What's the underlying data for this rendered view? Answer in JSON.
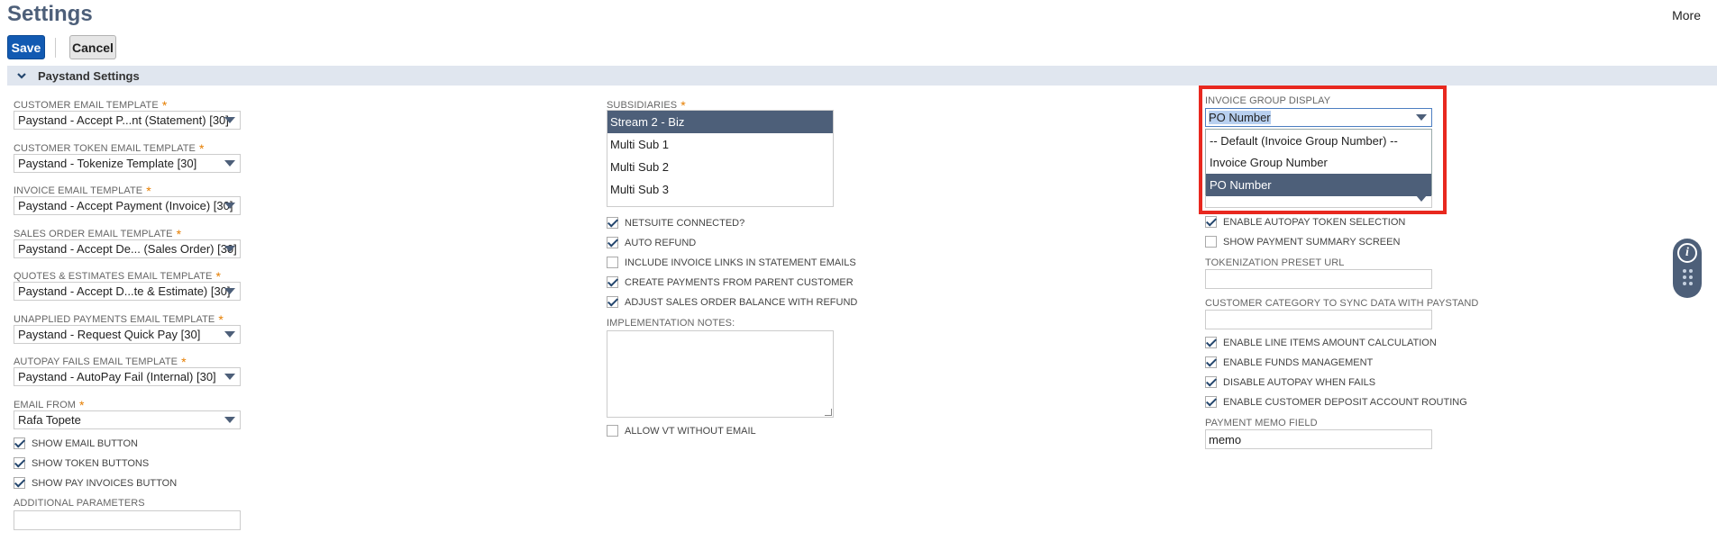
{
  "header": {
    "title": "Settings",
    "more_label": "More",
    "save_label": "Save",
    "cancel_label": "Cancel"
  },
  "section": {
    "title": "Paystand Settings"
  },
  "left_column": {
    "fields": [
      {
        "label": "CUSTOMER EMAIL TEMPLATE",
        "value": "Paystand - Accept P...nt (Statement) [30]"
      },
      {
        "label": "CUSTOMER TOKEN EMAIL TEMPLATE",
        "value": "Paystand - Tokenize Template [30]"
      },
      {
        "label": "INVOICE EMAIL TEMPLATE",
        "value": "Paystand - Accept Payment (Invoice) [30]"
      },
      {
        "label": "SALES ORDER EMAIL TEMPLATE",
        "value": "Paystand - Accept De... (Sales Order) [30]"
      },
      {
        "label": "QUOTES & ESTIMATES EMAIL TEMPLATE",
        "value": "Paystand - Accept D...te & Estimate) [30]"
      },
      {
        "label": "UNAPPLIED PAYMENTS EMAIL TEMPLATE",
        "value": "Paystand - Request Quick Pay [30]"
      },
      {
        "label": "AUTOPAY FAILS EMAIL TEMPLATE",
        "value": "Paystand - AutoPay Fail (Internal) [30]"
      },
      {
        "label": "EMAIL FROM",
        "value": "Rafa Topete"
      }
    ],
    "required_mark": "*",
    "checkboxes": [
      {
        "label": "SHOW EMAIL BUTTON",
        "checked": true
      },
      {
        "label": "SHOW TOKEN BUTTONS",
        "checked": true
      },
      {
        "label": "SHOW PAY INVOICES BUTTON",
        "checked": true
      }
    ],
    "additional_params_label": "ADDITIONAL PARAMETERS",
    "additional_params_value": ""
  },
  "middle_column": {
    "subsidiaries_label": "SUBSIDIARIES",
    "subsidiaries": [
      {
        "label": "Stream 2 - Biz",
        "selected": true
      },
      {
        "label": "Multi Sub 1",
        "selected": false
      },
      {
        "label": "Multi Sub 2",
        "selected": false
      },
      {
        "label": "Multi Sub 3",
        "selected": false
      }
    ],
    "checkboxes": [
      {
        "label": "NETSUITE CONNECTED?",
        "checked": true
      },
      {
        "label": "AUTO REFUND",
        "checked": true
      },
      {
        "label": "INCLUDE INVOICE LINKS IN STATEMENT EMAILS",
        "checked": false
      },
      {
        "label": "CREATE PAYMENTS FROM PARENT CUSTOMER",
        "checked": true
      },
      {
        "label": "ADJUST SALES ORDER BALANCE WITH REFUND",
        "checked": true
      }
    ],
    "notes_label": "IMPLEMENTATION NOTES:",
    "allow_vt_label": "ALLOW VT WITHOUT EMAIL",
    "allow_vt_checked": false
  },
  "right_column": {
    "invoice_group_label": "INVOICE GROUP DISPLAY",
    "invoice_group_value": "PO Number",
    "invoice_group_options": [
      {
        "label": "-- Default (Invoice Group Number) --",
        "selected": false
      },
      {
        "label": "Invoice Group Number",
        "selected": false
      },
      {
        "label": "PO Number",
        "selected": true
      }
    ],
    "checkboxes_top": [
      {
        "label": "ENABLE AUTOPAY TOKEN SELECTION",
        "checked": true
      },
      {
        "label": "SHOW PAYMENT SUMMARY SCREEN",
        "checked": false
      }
    ],
    "tokenization_label": "TOKENIZATION PRESET URL",
    "tokenization_value": "",
    "customer_category_label": "CUSTOMER CATEGORY TO SYNC DATA WITH PAYSTAND",
    "customer_category_value": "",
    "checkboxes_bottom": [
      {
        "label": "ENABLE LINE ITEMS AMOUNT CALCULATION",
        "checked": true
      },
      {
        "label": "ENABLE FUNDS MANAGEMENT",
        "checked": true
      },
      {
        "label": "DISABLE AUTOPAY WHEN FAILS",
        "checked": true
      },
      {
        "label": "ENABLE CUSTOMER DEPOSIT ACCOUNT ROUTING",
        "checked": true
      }
    ],
    "memo_label": "PAYMENT MEMO FIELD",
    "memo_value": "memo"
  },
  "side_widget": {
    "info_glyph": "i"
  },
  "colors": {
    "primary": "#125ab2",
    "heading": "#4d5f79",
    "highlight_border": "#e8281f",
    "required": "#e67e00"
  }
}
